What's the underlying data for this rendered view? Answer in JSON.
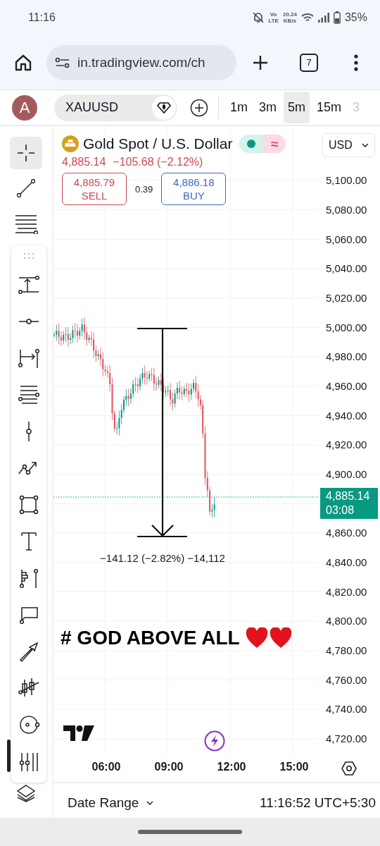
{
  "status_bar": {
    "time": "11:16",
    "volte_top": "Vo",
    "volte_bottom": "LTE",
    "speed": "20.24",
    "speed_unit": "KB/s",
    "battery": "35%"
  },
  "browser": {
    "url": "in.tradingview.com/ch",
    "tab_count": "7"
  },
  "toolbar": {
    "avatar": "A",
    "symbol": "XAUUSD",
    "timeframes": [
      {
        "label": "1m",
        "selected": false,
        "faded": false
      },
      {
        "label": "3m",
        "selected": false,
        "faded": false
      },
      {
        "label": "5m",
        "selected": true,
        "faded": false
      },
      {
        "label": "15m",
        "selected": false,
        "faded": false
      },
      {
        "label": "3",
        "selected": false,
        "faded": true
      }
    ]
  },
  "left_tools": [
    {
      "selected": true
    },
    {
      "selected": false
    },
    {
      "selected": false
    }
  ],
  "legend": {
    "title": "Gold Spot / U.S. Dollar",
    "approx_symbol": "≈",
    "last": "4,885.14",
    "change": "−105.68 (−2.12%)",
    "sell_price": "4,885.79",
    "sell_label": "SELL",
    "spread": "0.39",
    "buy_price": "4,886.18",
    "buy_label": "BUY"
  },
  "currency": "USD",
  "price_scale": [
    {
      "kind": "tick",
      "label": "5,100.00"
    },
    {
      "kind": "tick",
      "label": "5,080.00"
    },
    {
      "kind": "tick",
      "label": "5,060.00"
    },
    {
      "kind": "tick",
      "label": "5,040.00"
    },
    {
      "kind": "tick",
      "label": "5,020.00"
    },
    {
      "kind": "tick",
      "label": "5,000.00"
    },
    {
      "kind": "tick",
      "label": "4,980.00"
    },
    {
      "kind": "tick",
      "label": "4,960.00"
    },
    {
      "kind": "tick",
      "label": "4,940.00"
    },
    {
      "kind": "tick",
      "label": "4,920.00"
    },
    {
      "kind": "tick",
      "label": "4,900.00"
    },
    {
      "kind": "current",
      "label": "4,885.14",
      "countdown": "03:08"
    },
    {
      "kind": "tick",
      "label": "4,860.00"
    },
    {
      "kind": "tick",
      "label": "4,840.00"
    },
    {
      "kind": "tick",
      "label": "4,820.00"
    },
    {
      "kind": "tick",
      "label": "4,800.00"
    },
    {
      "kind": "tick",
      "label": "4,780.00"
    },
    {
      "kind": "tick",
      "label": "4,760.00"
    },
    {
      "kind": "tick",
      "label": "4,740.00"
    },
    {
      "kind": "tick",
      "label": "4,720.00"
    }
  ],
  "measure_label": "−141.12 (−2.82%) −14,112",
  "note": {
    "text": "# GOD ABOVE ALL"
  },
  "time_scale": [
    "06:00",
    "09:00",
    "12:00",
    "15:00"
  ],
  "bottom_bar": {
    "date_range": "Date Range",
    "clock": "11:16:52 UTC+5:30"
  }
}
